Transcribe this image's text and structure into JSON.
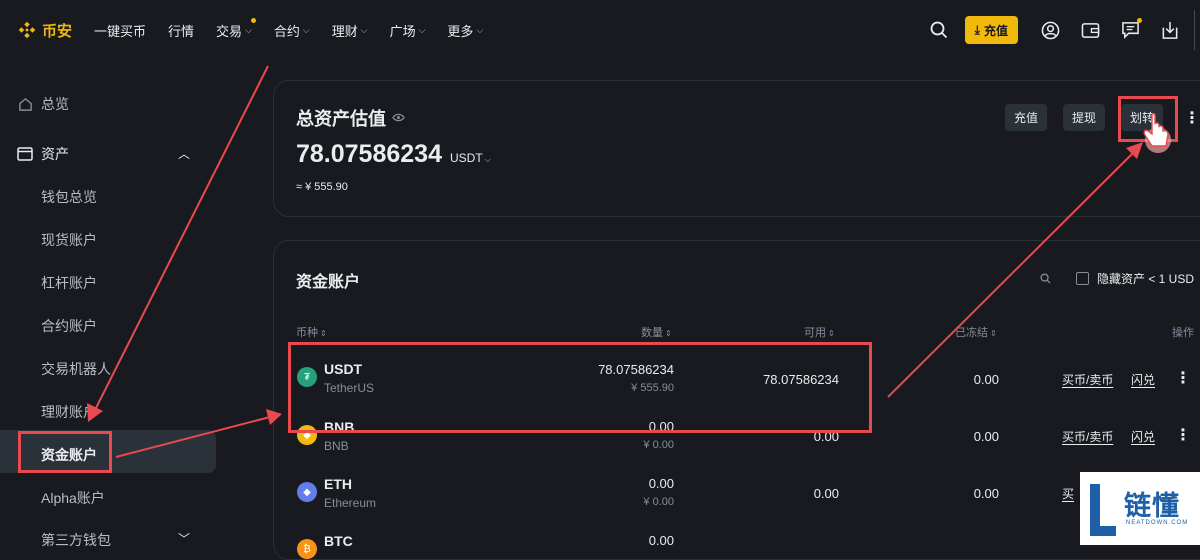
{
  "app": {
    "logo_text": "币安",
    "brand_color": "#f0b90b",
    "annotation_color": "#e84a4f"
  },
  "nav": {
    "items": [
      {
        "label": "一键买币",
        "dropdown": false,
        "dot": false
      },
      {
        "label": "行情",
        "dropdown": false,
        "dot": false
      },
      {
        "label": "交易",
        "dropdown": true,
        "dot": true
      },
      {
        "label": "合约",
        "dropdown": true,
        "dot": false
      },
      {
        "label": "理财",
        "dropdown": true,
        "dot": false
      },
      {
        "label": "广场",
        "dropdown": true,
        "dot": false
      },
      {
        "label": "更多",
        "dropdown": true,
        "dot": false
      }
    ],
    "deposit_label": "充值",
    "icons": [
      "search-icon",
      "download-arrow-icon",
      "user-icon",
      "wallet-icon",
      "message-icon",
      "download-app-icon"
    ]
  },
  "sidebar": {
    "overview": "总览",
    "assets": "资产",
    "items": [
      "钱包总览",
      "现货账户",
      "杠杆账户",
      "合约账户",
      "交易机器人",
      "理财账户"
    ],
    "active": "资金账户",
    "after": [
      "Alpha账户",
      "第三方钱包"
    ]
  },
  "summary": {
    "title": "总资产估值",
    "value": "78.07586234",
    "unit": "USDT",
    "cny": "≈ ¥ 555.90",
    "buttons": {
      "deposit": "充值",
      "withdraw": "提现",
      "transfer": "划转"
    }
  },
  "funding": {
    "title": "资金账户",
    "hide_small": "隐藏资产 < 1 USD",
    "headers": {
      "coin": "币种",
      "amount": "数量",
      "available": "可用",
      "frozen": "已冻结",
      "action": "操作"
    },
    "rows": [
      {
        "symbol": "USDT",
        "name": "TetherUS",
        "amount": "78.07586234",
        "amount_cny": "¥ 555.90",
        "available": "78.07586234",
        "frozen": "0.00",
        "action1": "买币/卖币",
        "action2": "闪兑",
        "icon_color": "#26a17b",
        "icon_glyph": "₮"
      },
      {
        "symbol": "BNB",
        "name": "BNB",
        "amount": "0.00",
        "amount_cny": "¥ 0.00",
        "available": "0.00",
        "frozen": "0.00",
        "action1": "买币/卖币",
        "action2": "闪兑",
        "icon_color": "#f0b90b",
        "icon_glyph": "◆"
      },
      {
        "symbol": "ETH",
        "name": "Ethereum",
        "amount": "0.00",
        "amount_cny": "¥ 0.00",
        "available": "0.00",
        "frozen": "0.00",
        "action1": "买",
        "action2": "",
        "icon_color": "#627eea",
        "icon_glyph": "◆"
      },
      {
        "symbol": "BTC",
        "name": "",
        "amount": "0.00",
        "amount_cny": "",
        "available": "",
        "frozen": "",
        "action1": "",
        "action2": "",
        "icon_color": "#f7931a",
        "icon_glyph": "₿"
      }
    ]
  },
  "watermark": {
    "text": "链懂",
    "sub": "NEATDOWN.COM"
  }
}
